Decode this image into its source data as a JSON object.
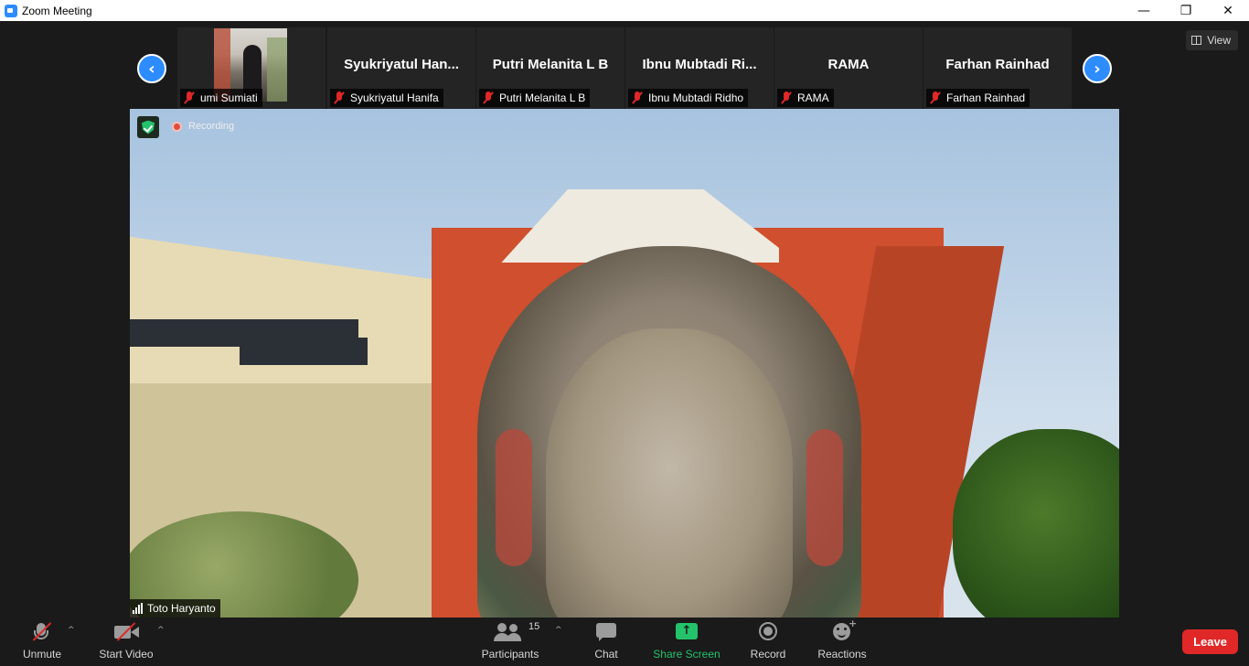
{
  "window": {
    "title": "Zoom Meeting",
    "controls": {
      "minimize": "—",
      "restore": "❐",
      "close": "✕"
    }
  },
  "strip": {
    "prev_icon": "‹",
    "next_icon": "›",
    "tiles": [
      {
        "display_name": "",
        "label": "umi Sumiati",
        "has_photo": true
      },
      {
        "display_name": "Syukriyatul  Han...",
        "label": "Syukriyatul Hanifa"
      },
      {
        "display_name": "Putri Melanita L B",
        "label": "Putri Melanita L B"
      },
      {
        "display_name": "Ibnu  Mubtadi  Ri...",
        "label": "Ibnu Mubtadi Ridho"
      },
      {
        "display_name": "RAMA",
        "label": "RAMA"
      },
      {
        "display_name": "Farhan Rainhad",
        "label": "Farhan Rainhad"
      }
    ]
  },
  "view_button": {
    "label": "View"
  },
  "video": {
    "recording_label": "Recording",
    "speaker_name": "Toto Haryanto"
  },
  "toolbar": {
    "unmute": "Unmute",
    "start_video": "Start Video",
    "participants": "Participants",
    "participants_count": "15",
    "chat": "Chat",
    "share_screen": "Share Screen",
    "record": "Record",
    "reactions": "Reactions",
    "leave": "Leave",
    "caret": "^",
    "share_arrow": "↑"
  },
  "colors": {
    "accent": "#2d8cff",
    "share_green": "#23c26b",
    "leave_red": "#e02828",
    "muted_red": "#e02828"
  }
}
